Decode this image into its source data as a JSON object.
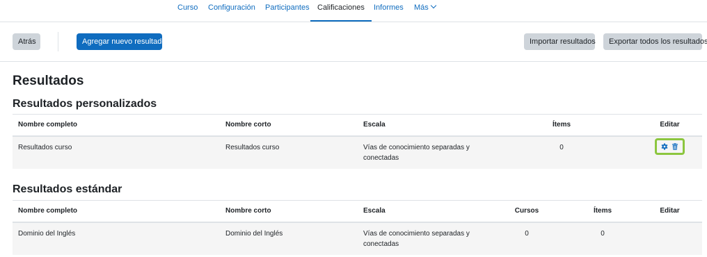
{
  "nav": {
    "tabs": [
      {
        "label": "Curso"
      },
      {
        "label": "Configuración"
      },
      {
        "label": "Participantes"
      },
      {
        "label": "Calificaciones"
      },
      {
        "label": "Informes"
      },
      {
        "label": "Más"
      }
    ]
  },
  "toolbar": {
    "back_label": "Atrás",
    "add_label": "Agregar nuevo resultado",
    "import_label": "Importar resultados",
    "export_label": "Exportar todos los resultados"
  },
  "page_title": "Resultados",
  "custom": {
    "heading": "Resultados personalizados",
    "headers": [
      "Nombre completo",
      "Nombre corto",
      "Escala",
      "Ítems",
      "Editar"
    ],
    "rows": [
      {
        "full": "Resultados curso",
        "short": "Resultados curso",
        "scale": "Vías de conocimiento separadas y conectadas",
        "items": "0"
      }
    ]
  },
  "standard": {
    "heading": "Resultados estándar",
    "headers": [
      "Nombre completo",
      "Nombre corto",
      "Escala",
      "Cursos",
      "Ítems",
      "Editar"
    ],
    "rows": [
      {
        "full": "Dominio del Inglés",
        "short": "Dominio del Inglés",
        "scale": "Vías de conocimiento separadas y conectadas",
        "courses": "0",
        "items": "0"
      }
    ]
  },
  "icons": {
    "edit": "gear-icon",
    "delete": "trash-icon"
  },
  "colors": {
    "primary": "#0f6cbf",
    "highlight": "#8cc63f"
  }
}
